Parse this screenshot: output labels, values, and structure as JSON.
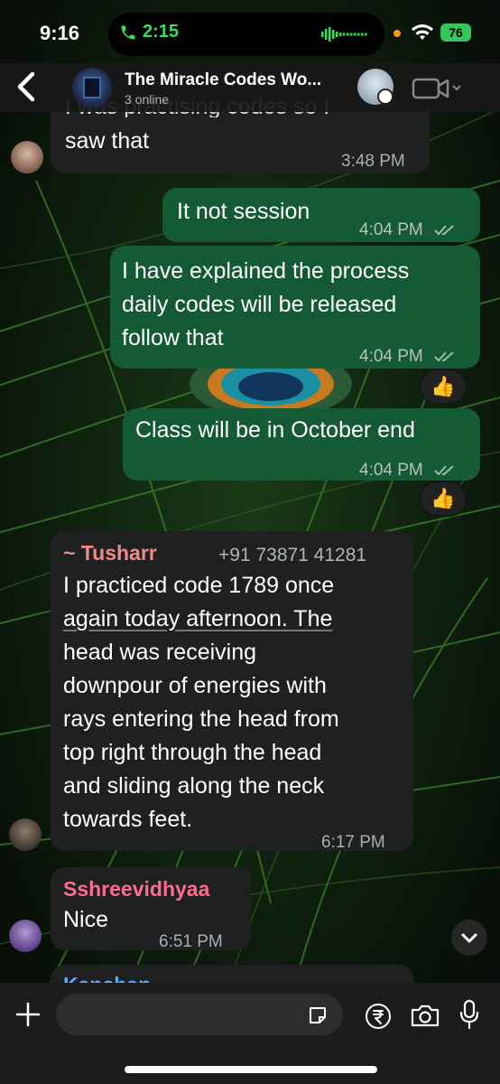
{
  "status_bar": {
    "time": "9:16",
    "call_duration": "2:15",
    "battery": "76"
  },
  "header": {
    "title": "The Miracle Codes Wo...",
    "subtitle": "3 online"
  },
  "messages": [
    {
      "direction": "in",
      "text_top": "I was practising codes so I",
      "text": "saw that",
      "time": "3:48 PM"
    },
    {
      "direction": "out",
      "text": "It not session",
      "time": "4:04 PM"
    },
    {
      "direction": "out",
      "lines": [
        "I have explained the process",
        "daily codes will be released",
        "follow that"
      ],
      "time": "4:04 PM",
      "reaction": "👍"
    },
    {
      "direction": "out",
      "text": "Class will be in October end",
      "time": "4:04 PM",
      "reaction": "👍"
    },
    {
      "direction": "in",
      "sender": "~ Tusharr",
      "phone": "+91 73871 41281",
      "lines": [
        "I practiced code 1789 once",
        "again today afternoon. The",
        "head was receiving",
        "downpour of energies with",
        "rays entering the head from",
        "top right through the head",
        "and sliding along the neck",
        "towards feet."
      ],
      "time": "6:17 PM"
    },
    {
      "direction": "in",
      "sender": "Sshreevidhyaa",
      "text": "Nice",
      "time": "6:51 PM"
    },
    {
      "direction": "in",
      "sender": "Kanchan"
    }
  ],
  "colors": {
    "incoming": "#1f2121",
    "outgoing": "#145a35",
    "sender_tusharr": "#f08a8a",
    "sender_sshree": "#ff6b8e",
    "sender_kanchan": "#5da8ff"
  },
  "composer": {
    "placeholder": ""
  }
}
